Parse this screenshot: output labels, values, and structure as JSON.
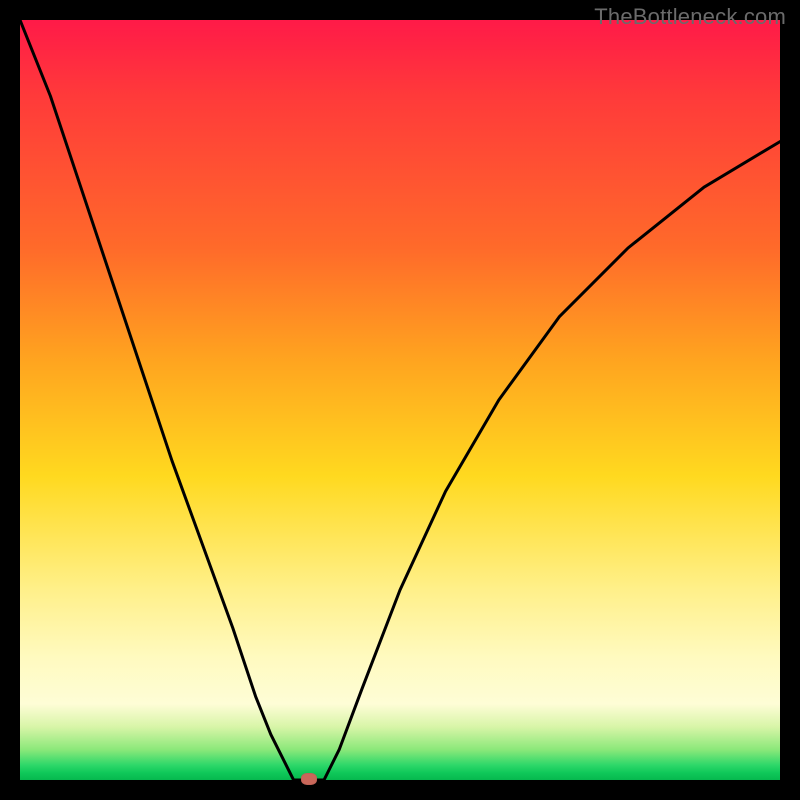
{
  "watermark": "TheBottleneck.com",
  "colors": {
    "frame": "#000000",
    "curve": "#000000",
    "marker": "#c9675a",
    "gradient_stops": [
      "#ff1a48",
      "#ff3a3a",
      "#ff6a2a",
      "#ffa51f",
      "#ffd91f",
      "#fff08a",
      "#fffac0",
      "#fefdd6",
      "#d8f5a8",
      "#8be87a",
      "#2fd86a",
      "#10c95a",
      "#06b84e"
    ]
  },
  "chart_data": {
    "type": "line",
    "title": "",
    "xlabel": "",
    "ylabel": "",
    "xlim": [
      0,
      100
    ],
    "ylim": [
      0,
      100
    ],
    "grid": false,
    "legend": false,
    "annotations": [
      "TheBottleneck.com"
    ],
    "background": "red-to-green vertical gradient (bottleneck heatmap)",
    "marker": {
      "x": 38,
      "y": 0
    },
    "series": [
      {
        "name": "left-branch",
        "x": [
          0,
          4,
          8,
          12,
          16,
          20,
          24,
          28,
          31,
          33,
          35,
          36
        ],
        "y": [
          100,
          90,
          78,
          66,
          54,
          42,
          31,
          20,
          11,
          6,
          2,
          0
        ]
      },
      {
        "name": "flat-bottom",
        "x": [
          36,
          40
        ],
        "y": [
          0,
          0
        ]
      },
      {
        "name": "right-branch",
        "x": [
          40,
          42,
          45,
          50,
          56,
          63,
          71,
          80,
          90,
          100
        ],
        "y": [
          0,
          4,
          12,
          25,
          38,
          50,
          61,
          70,
          78,
          84
        ]
      }
    ]
  }
}
